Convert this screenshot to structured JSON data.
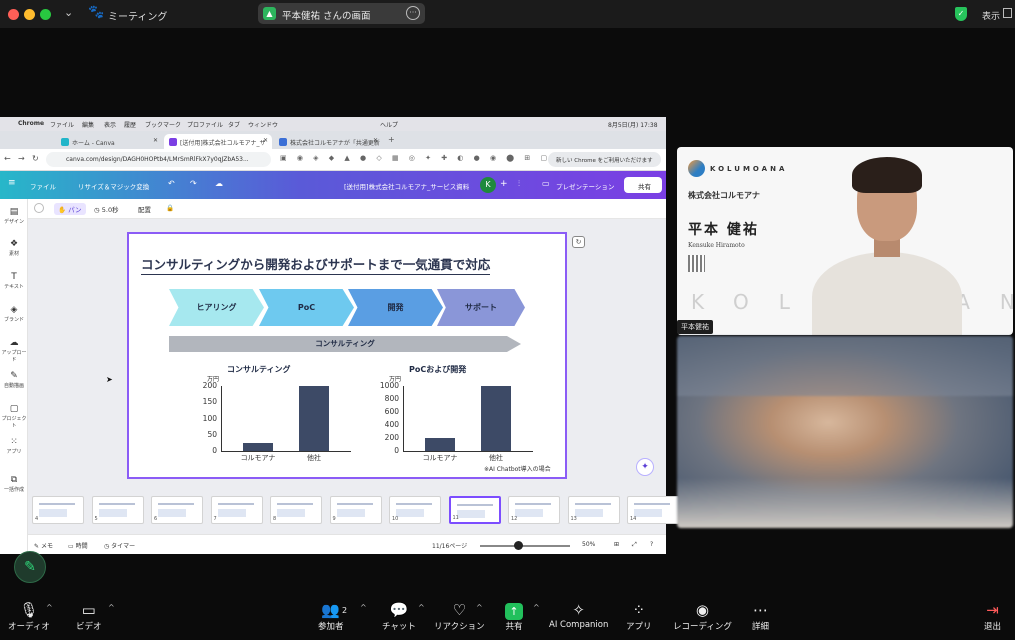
{
  "zoom": {
    "meeting_label": "ミーティング",
    "share_label": "平本健祐 さんの画面",
    "view_label": "表示",
    "participant_count": "2",
    "controls": {
      "audio": "オーディオ",
      "video": "ビデオ",
      "participants": "参加者",
      "chat": "チャット",
      "reactions": "リアクション",
      "share": "共有",
      "ai": "AI Companion",
      "apps": "アプリ",
      "recording": "レコーディング",
      "details": "詳細",
      "leave": "退出"
    }
  },
  "mac": {
    "menu": [
      "Chrome",
      "ファイル",
      "編集",
      "表示",
      "履歴",
      "ブックマーク",
      "プロファイル",
      "タブ",
      "ウィンドウ",
      "ヘルプ"
    ],
    "clock": "8月5日(月) 17:38"
  },
  "chrome": {
    "tabs": [
      "ホーム - Canva",
      "[送付用]株式会社コルモアナ_サ",
      "株式会社コルモアナが「共通更新"
    ],
    "url": "canva.com/design/DAGH0HOPtb4/LMrSmRlFkX7y0qJZbA53...",
    "update": "新しい Chrome をご利用いただけます"
  },
  "canva": {
    "file": "ファイル",
    "resize": "リサイズ＆マジック変換",
    "doc_title": "[送付用]株式会社コルモアナ_サービス資料",
    "avatar": "K",
    "present": "プレゼンテーション",
    "share": "共有",
    "sidebar": [
      "デザイン",
      "素材",
      "テキスト",
      "ブランド",
      "アップロード",
      "自動描画",
      "プロジェクト",
      "アプリ",
      "一括作成"
    ],
    "tools": {
      "pan": "パン",
      "duration": "5.0秒",
      "arrange": "配置"
    },
    "bottom": {
      "notes": "メモ",
      "time": "時間",
      "timer": "タイマー",
      "page": "11/16ページ",
      "zoom": "50%"
    },
    "thumbs": [
      "4",
      "5",
      "6",
      "7",
      "8",
      "9",
      "10",
      "11",
      "12",
      "13",
      "14"
    ]
  },
  "slide": {
    "title": "コンサルティングから開発およびサポートまで一気通貫で対応",
    "steps": [
      "ヒアリング",
      "PoC",
      "開発",
      "サポート"
    ],
    "step_colors": [
      "#a6e8ef",
      "#6ec9ef",
      "#5a9ee3",
      "#8a96d8"
    ],
    "consult_bar": "コンサルティング",
    "note": "※AI Chatbot導入の場合"
  },
  "chart_data": [
    {
      "type": "bar",
      "title": "コンサルティング",
      "categories": [
        "コルモアナ",
        "他社"
      ],
      "values": [
        25,
        200
      ],
      "ylabel": "万円",
      "yticks": [
        "200",
        "150",
        "100",
        "50",
        "0"
      ],
      "ylim": [
        0,
        200
      ]
    },
    {
      "type": "bar",
      "title": "PoCおよび開発",
      "categories": [
        "コルモアナ",
        "他社"
      ],
      "values": [
        200,
        1000
      ],
      "ylabel": "万円",
      "yticks": [
        "1000",
        "800",
        "600",
        "400",
        "200",
        "0"
      ],
      "ylim": [
        0,
        1000
      ]
    }
  ],
  "participants": {
    "card_logo": "KOLUMOANA",
    "card_company": "株式会社コルモアナ",
    "card_name": "平本 健祐",
    "card_roman": "Kensuke Hiramoto",
    "watermark": "KOLUMOANA",
    "name_tag": "平本健祐"
  }
}
